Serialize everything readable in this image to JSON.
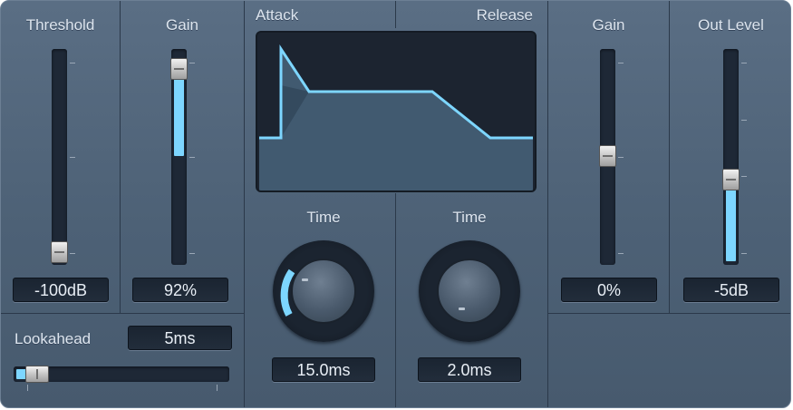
{
  "left": {
    "threshold": {
      "label": "Threshold",
      "value": "-100dB",
      "level": 0.0
    },
    "gain": {
      "label": "Gain",
      "value": "92%",
      "level": 0.92
    }
  },
  "envelope": {
    "attack_label": "Attack",
    "release_label": "Release",
    "attack_time": {
      "label": "Time",
      "value": "15.0ms"
    },
    "release_time": {
      "label": "Time",
      "value": "2.0ms"
    }
  },
  "right": {
    "gain": {
      "label": "Gain",
      "value": "0%",
      "level": 0.5
    },
    "out_level": {
      "label": "Out Level",
      "value": "-5dB",
      "level": 0.38
    }
  },
  "lookahead": {
    "label": "Lookahead",
    "value": "5ms"
  },
  "colors": {
    "accent": "#7dd6ff",
    "panel": "#51657a",
    "display": "#1c2430"
  }
}
